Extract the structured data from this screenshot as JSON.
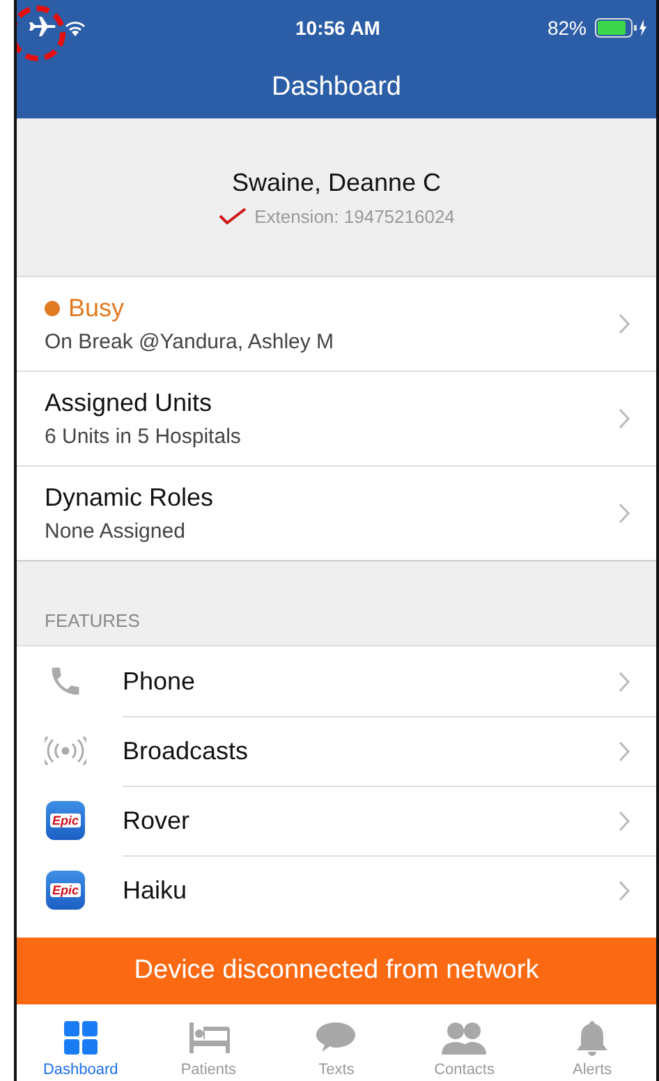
{
  "status_bar": {
    "time": "10:56 AM",
    "battery": "82%"
  },
  "title": "Dashboard",
  "profile": {
    "name": "Swaine, Deanne C",
    "extension": "Extension: 19475216024"
  },
  "status_rows": [
    {
      "kind": "status",
      "title": "Busy",
      "color": "#e07b24",
      "subtitle": "On Break @Yandura, Ashley M"
    },
    {
      "kind": "plain",
      "title": "Assigned Units",
      "subtitle": "6 Units in 5 Hospitals"
    },
    {
      "kind": "plain",
      "title": "Dynamic Roles",
      "subtitle": "None Assigned"
    }
  ],
  "features": {
    "heading": "FEATURES",
    "items": [
      {
        "kind": "phone",
        "label": "Phone"
      },
      {
        "kind": "broadcast",
        "label": "Broadcasts"
      },
      {
        "kind": "app",
        "label": "Rover",
        "icon_label": "Epic"
      },
      {
        "kind": "app",
        "label": "Haiku",
        "icon_label": "Epic"
      }
    ]
  },
  "banner": "Device disconnected from network",
  "tabs": [
    {
      "kind": "dashboard",
      "label": "Dashboard",
      "selected": true
    },
    {
      "kind": "patients",
      "label": "Patients",
      "selected": false
    },
    {
      "kind": "texts",
      "label": "Texts",
      "selected": false
    },
    {
      "kind": "contacts",
      "label": "Contacts",
      "selected": false
    },
    {
      "kind": "alerts",
      "label": "Alerts",
      "selected": false
    }
  ]
}
